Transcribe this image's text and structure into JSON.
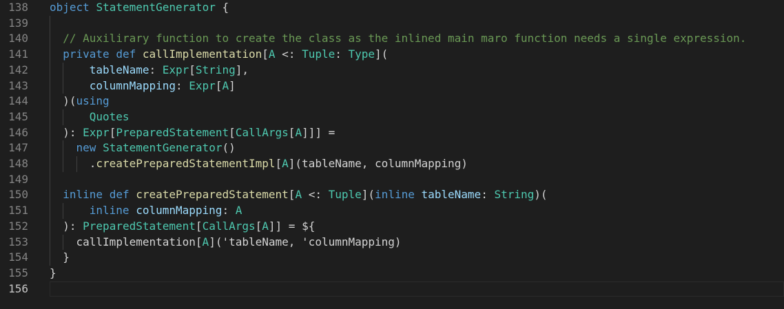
{
  "lines": [
    {
      "n": "138",
      "indent": 0,
      "tokens": [
        [
          "kw",
          "object"
        ],
        [
          "pl",
          " "
        ],
        [
          "ty",
          "StatementGenerator"
        ],
        [
          "pl",
          " {"
        ]
      ]
    },
    {
      "n": "139",
      "indent": 0,
      "tokens": []
    },
    {
      "n": "140",
      "indent": 2,
      "tokens": [
        [
          "cm",
          "// Auxilirary function to create the class as the inlined main maro function needs a single expression."
        ]
      ]
    },
    {
      "n": "141",
      "indent": 2,
      "tokens": [
        [
          "kw",
          "private"
        ],
        [
          "pl",
          " "
        ],
        [
          "kw",
          "def"
        ],
        [
          "pl",
          " "
        ],
        [
          "fn",
          "callImplementation"
        ],
        [
          "pl",
          "["
        ],
        [
          "ty",
          "A"
        ],
        [
          "pl",
          " <: "
        ],
        [
          "ty",
          "Tuple"
        ],
        [
          "pl",
          ": "
        ],
        [
          "ty",
          "Type"
        ],
        [
          "pl",
          "]("
        ]
      ]
    },
    {
      "n": "142",
      "indent": 6,
      "tokens": [
        [
          "pa",
          "tableName"
        ],
        [
          "pl",
          ": "
        ],
        [
          "ty",
          "Expr"
        ],
        [
          "pl",
          "["
        ],
        [
          "ty",
          "String"
        ],
        [
          "pl",
          "],"
        ]
      ]
    },
    {
      "n": "143",
      "indent": 6,
      "tokens": [
        [
          "pa",
          "columnMapping"
        ],
        [
          "pl",
          ": "
        ],
        [
          "ty",
          "Expr"
        ],
        [
          "pl",
          "["
        ],
        [
          "ty",
          "A"
        ],
        [
          "pl",
          "]"
        ]
      ]
    },
    {
      "n": "144",
      "indent": 2,
      "tokens": [
        [
          "pl",
          ")("
        ],
        [
          "kw",
          "using"
        ]
      ]
    },
    {
      "n": "145",
      "indent": 6,
      "tokens": [
        [
          "ty",
          "Quotes"
        ]
      ]
    },
    {
      "n": "146",
      "indent": 2,
      "tokens": [
        [
          "pl",
          "): "
        ],
        [
          "ty",
          "Expr"
        ],
        [
          "pl",
          "["
        ],
        [
          "ty",
          "PreparedStatement"
        ],
        [
          "pl",
          "["
        ],
        [
          "ty",
          "CallArgs"
        ],
        [
          "pl",
          "["
        ],
        [
          "ty",
          "A"
        ],
        [
          "pl",
          "]]] ="
        ]
      ]
    },
    {
      "n": "147",
      "indent": 4,
      "tokens": [
        [
          "kw",
          "new"
        ],
        [
          "pl",
          " "
        ],
        [
          "ty",
          "StatementGenerator"
        ],
        [
          "pl",
          "()"
        ]
      ]
    },
    {
      "n": "148",
      "indent": 6,
      "tokens": [
        [
          "pl",
          "."
        ],
        [
          "fn",
          "createPreparedStatementImpl"
        ],
        [
          "pl",
          "["
        ],
        [
          "ty",
          "A"
        ],
        [
          "pl",
          "](tableName, columnMapping)"
        ]
      ]
    },
    {
      "n": "149",
      "indent": 0,
      "tokens": []
    },
    {
      "n": "150",
      "indent": 2,
      "tokens": [
        [
          "kw",
          "inline"
        ],
        [
          "pl",
          " "
        ],
        [
          "kw",
          "def"
        ],
        [
          "pl",
          " "
        ],
        [
          "fn",
          "createPreparedStatement"
        ],
        [
          "pl",
          "["
        ],
        [
          "ty",
          "A"
        ],
        [
          "pl",
          " <: "
        ],
        [
          "ty",
          "Tuple"
        ],
        [
          "pl",
          "]("
        ],
        [
          "kw",
          "inline"
        ],
        [
          "pl",
          " "
        ],
        [
          "pa",
          "tableName"
        ],
        [
          "pl",
          ": "
        ],
        [
          "ty",
          "String"
        ],
        [
          "pl",
          ")("
        ]
      ]
    },
    {
      "n": "151",
      "indent": 6,
      "tokens": [
        [
          "kw",
          "inline"
        ],
        [
          "pl",
          " "
        ],
        [
          "pa",
          "columnMapping"
        ],
        [
          "pl",
          ": "
        ],
        [
          "ty",
          "A"
        ]
      ]
    },
    {
      "n": "152",
      "indent": 2,
      "tokens": [
        [
          "pl",
          "): "
        ],
        [
          "ty",
          "PreparedStatement"
        ],
        [
          "pl",
          "["
        ],
        [
          "ty",
          "CallArgs"
        ],
        [
          "pl",
          "["
        ],
        [
          "ty",
          "A"
        ],
        [
          "pl",
          "]] = ${"
        ]
      ]
    },
    {
      "n": "153",
      "indent": 4,
      "tokens": [
        [
          "pl",
          "callImplementation["
        ],
        [
          "ty",
          "A"
        ],
        [
          "pl",
          "]('tableName, 'columnMapping)"
        ]
      ]
    },
    {
      "n": "154",
      "indent": 2,
      "tokens": [
        [
          "pl",
          "}"
        ]
      ]
    },
    {
      "n": "155",
      "indent": 0,
      "tokens": [
        [
          "pl",
          "}"
        ]
      ]
    },
    {
      "n": "156",
      "indent": 0,
      "tokens": []
    }
  ],
  "active_line": "156",
  "colors": {
    "background": "#1e1e1e",
    "keyword": "#569cd6",
    "type": "#4ec9b0",
    "function": "#dcdcaa",
    "parameter": "#9cdcfe",
    "comment": "#6a9955",
    "plain": "#d4d4d4",
    "line_number": "#858585"
  }
}
